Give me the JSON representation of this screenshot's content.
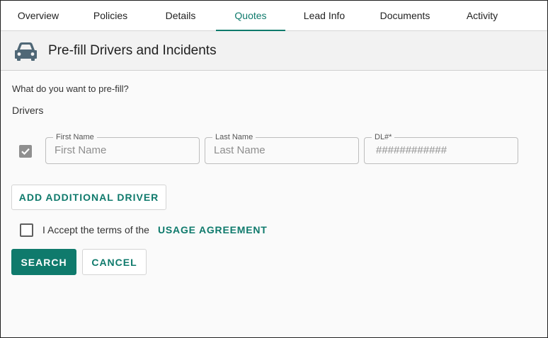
{
  "tabs": [
    {
      "label": "Overview",
      "active": false
    },
    {
      "label": "Policies",
      "active": false
    },
    {
      "label": "Details",
      "active": false
    },
    {
      "label": "Quotes",
      "active": true
    },
    {
      "label": "Lead Info",
      "active": false
    },
    {
      "label": "Documents",
      "active": false
    },
    {
      "label": "Activity",
      "active": false
    }
  ],
  "section": {
    "title": "Pre-fill Drivers and Incidents",
    "icon": "car-icon"
  },
  "form": {
    "question": "What do you want to pre-fill?",
    "drivers_label": "Drivers",
    "driver_checked": true,
    "fields": {
      "first_name": {
        "label": "First Name",
        "value": "",
        "placeholder": "First Name"
      },
      "last_name": {
        "label": "Last Name",
        "value": "",
        "placeholder": "Last Name"
      },
      "dl": {
        "label": "DL#*",
        "value": "",
        "placeholder": "############"
      }
    },
    "add_driver_label": "ADD ADDITIONAL DRIVER",
    "agreement": {
      "checked": false,
      "text": "I Accept the terms of the",
      "link": "USAGE AGREEMENT"
    },
    "search_label": "SEARCH",
    "cancel_label": "CANCEL"
  },
  "colors": {
    "accent": "#0f7a6c",
    "checkbox_checked": "#8f8f8f"
  }
}
